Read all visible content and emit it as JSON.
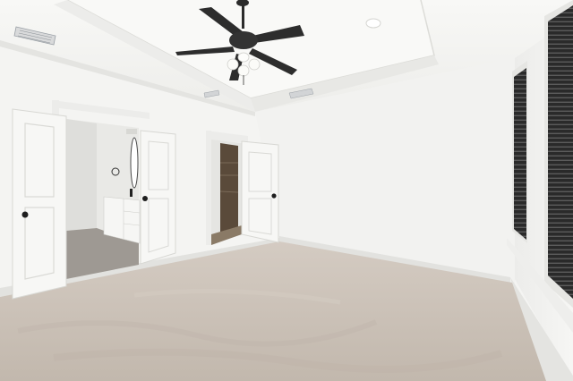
{
  "scene": {
    "subject": "empty-bedroom-interior",
    "colors": {
      "wall": "#f3f3f1",
      "wall_shadow": "#e6e6e3",
      "ceiling": "#f7f7f5",
      "carpet": "#cbc1b7",
      "trim": "#e9e9e6",
      "door": "#f6f6f4",
      "blinds": "#2c2c2c",
      "fan": "#2b2b2b",
      "bath_floor": "#9e9993",
      "closet_dark": "#5a4a3a"
    },
    "fixtures": {
      "ceiling_fan": "ceiling-fan-with-light-kit",
      "recessed_light": "recessed-light",
      "vents": "air-vent"
    }
  }
}
